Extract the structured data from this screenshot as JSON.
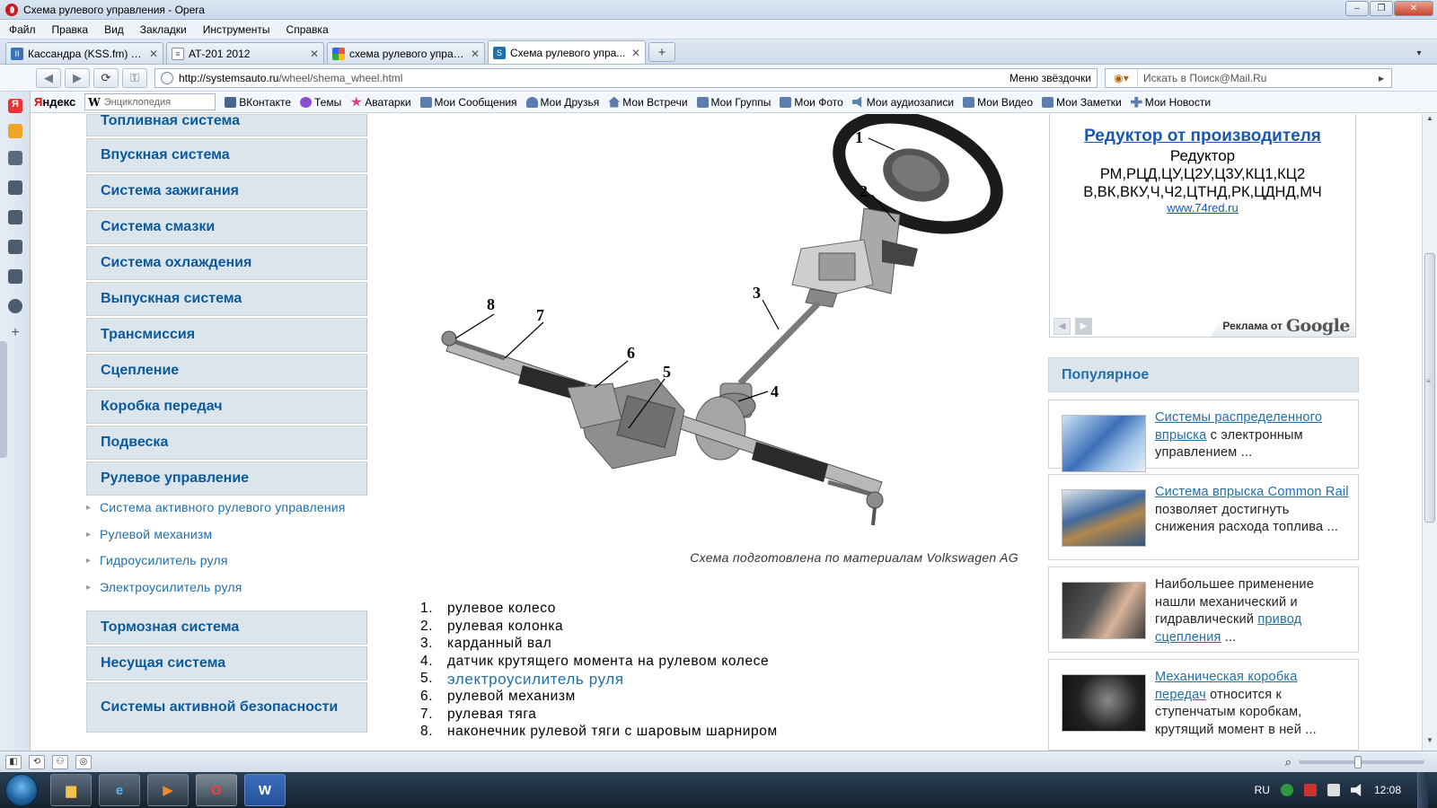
{
  "window": {
    "title": "Схема рулевого управления - Opera"
  },
  "menu": [
    "Файл",
    "Правка",
    "Вид",
    "Закладки",
    "Инструменты",
    "Справка"
  ],
  "tabs": [
    {
      "label": "Кассандра (KSS.fm) - ...",
      "icon": "pause-icon",
      "color": "#3b72b6"
    },
    {
      "label": "АТ-201 2012",
      "icon": "document-icon",
      "color": "#8a8f99"
    },
    {
      "label": "схема рулевого управ...",
      "icon": "google-icon",
      "color": "#3b8a3b"
    },
    {
      "label": "Схема рулевого упра...",
      "icon": "site-icon",
      "color": "#1f6fab",
      "active": true
    }
  ],
  "address": {
    "host": "http://systemsauto.ru",
    "path": "/wheel/shema_wheel.html",
    "speed_dial": "Меню звёздочки"
  },
  "search": {
    "placeholder": "Искать в Поиск@Mail.Ru"
  },
  "bookmarks": {
    "yandex": "Яндекс",
    "wiki_placeholder": "Энциклопедия",
    "items": [
      {
        "label": "ВКонтакте",
        "color": "#45668e"
      },
      {
        "label": "Темы",
        "color": "#8a4bd6"
      },
      {
        "label": "Аватарки",
        "color": "#d6428a"
      },
      {
        "label": "Мои Сообщения",
        "color": "#5a7fae"
      },
      {
        "label": "Мои Друзья",
        "color": "#5a7fae"
      },
      {
        "label": "Мои Встречи",
        "color": "#5a7fae"
      },
      {
        "label": "Мои Группы",
        "color": "#5a7fae"
      },
      {
        "label": "Мои Фото",
        "color": "#5a7fae"
      },
      {
        "label": "Мои аудиозаписи",
        "color": "#5a7fae"
      },
      {
        "label": "Мои Видео",
        "color": "#5a7fae"
      },
      {
        "label": "Мои Заметки",
        "color": "#5a7fae"
      },
      {
        "label": "Мои Новости",
        "color": "#5a7fae"
      }
    ]
  },
  "nav": {
    "top_items": [
      "Топливная система",
      "Впускная система",
      "Система зажигания",
      "Система смазки",
      "Система охлаждения",
      "Выпускная система",
      "Трансмиссия",
      "Сцепление",
      "Коробка передач",
      "Подвеска",
      "Рулевое управление"
    ],
    "sub_items": [
      "Система активного рулевого управления",
      "Рулевой механизм",
      "Гидроусилитель руля",
      "Электроусилитель руля"
    ],
    "bottom_items": [
      "Тормозная система",
      "Несущая система",
      "Системы активной безопасности"
    ]
  },
  "diagram": {
    "callouts": [
      "1",
      "2",
      "3",
      "4",
      "5",
      "6",
      "7",
      "8"
    ],
    "caption": "Схема подготовлена по материалам Volkswagen AG"
  },
  "parts": [
    {
      "num": "1.",
      "text": "рулевое колесо"
    },
    {
      "num": "2.",
      "text": "рулевая колонка"
    },
    {
      "num": "3.",
      "text": "карданный вал"
    },
    {
      "num": "4.",
      "text": "датчик крутящего момента на рулевом колесе"
    },
    {
      "num": "5.",
      "text": "электроусилитель руля",
      "link": true
    },
    {
      "num": "6.",
      "text": "рулевой механизм"
    },
    {
      "num": "7.",
      "text": "рулевая тяга"
    },
    {
      "num": "8.",
      "text": "наконечник рулевой тяги с шаровым шарниром"
    }
  ],
  "ad": {
    "title": "Редуктор от производителя",
    "line1": "Редуктор",
    "line2": "РМ,РЦД,ЦУ,Ц2У,Ц3У,КЦ1,КЦ2",
    "line3": "В,ВК,ВКУ,Ч,Ч2,ЦТНД,РК,ЦДНД,МЧ",
    "url": "www.74red.ru",
    "by": "Реклама от",
    "by_brand": "Google"
  },
  "popular": {
    "heading": "Популярное",
    "items": [
      {
        "link": "Системы распределенного впрыска",
        "rest": " с электронным управлением ..."
      },
      {
        "link": "Система впрыска Common Rail",
        "rest": " позволяет достигнуть снижения расхода топлива ..."
      },
      {
        "pre": "Наибольшее применение нашли механический и гидравлический ",
        "link": "привод сцепления",
        "rest": " ..."
      },
      {
        "link": "Механическая коробка передач",
        "rest": " относится к ступенчатым коробкам, крутящий момент в ней ..."
      }
    ]
  },
  "tray": {
    "lang": "RU",
    "time": "12:08"
  },
  "colors": {
    "nav_text": "#0a5a9c",
    "link": "#1f6fab",
    "nav_bg": "#dde5ec"
  }
}
